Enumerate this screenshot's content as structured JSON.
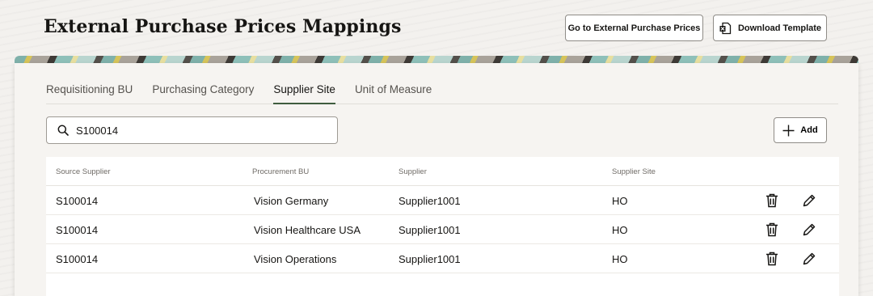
{
  "header": {
    "title": "External Purchase Prices Mappings",
    "goto_label": "Go to External Purchase Prices",
    "download_label": "Download Template"
  },
  "tabs": [
    {
      "label": "Requisitioning BU",
      "active": false
    },
    {
      "label": "Purchasing Category",
      "active": false
    },
    {
      "label": "Supplier Site",
      "active": true
    },
    {
      "label": "Unit of Measure",
      "active": false
    }
  ],
  "search": {
    "value": "S100014",
    "icon": "search-icon"
  },
  "add": {
    "label": "Add",
    "icon": "plus-icon"
  },
  "table": {
    "columns": [
      "Source Supplier",
      "Procurement BU",
      "Supplier",
      "Supplier Site"
    ],
    "rows": [
      {
        "source_supplier": "S100014",
        "procurement_bu": "Vision Germany",
        "supplier": "Supplier1001",
        "supplier_site": "HO"
      },
      {
        "source_supplier": "S100014",
        "procurement_bu": "Vision Healthcare USA",
        "supplier": "Supplier1001",
        "supplier_site": "HO"
      },
      {
        "source_supplier": "S100014",
        "procurement_bu": "Vision Operations",
        "supplier": "Supplier1001",
        "supplier_site": "HO"
      }
    ],
    "row_actions": [
      "trash-icon",
      "pencil-icon"
    ]
  },
  "colors": {
    "active_tab_underline": "#3f5d3f",
    "border": "#8f8c87"
  }
}
